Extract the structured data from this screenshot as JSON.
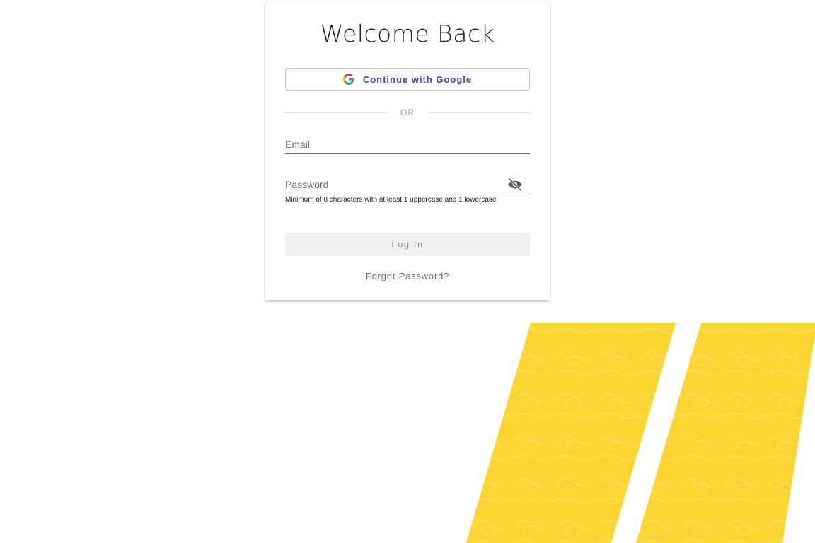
{
  "login": {
    "title": "Welcome Back",
    "google_button_label": "Continue with Google",
    "divider_text": "OR",
    "email_placeholder": "Email",
    "email_value": "",
    "password_placeholder": "Password",
    "password_value": "",
    "password_helper": "Minimum of 8 characters with at least 1 uppercase and 1 lowercase",
    "login_button_label": "Log In",
    "forgot_password_label": "Forgot Password?"
  },
  "icons": {
    "google": "google-g-icon",
    "password_visibility": "eye-off-icon"
  },
  "colors": {
    "accent_yellow": "#fbd632",
    "google_label": "#3d4aa5",
    "login_disabled_bg": "#f1f1f1"
  }
}
